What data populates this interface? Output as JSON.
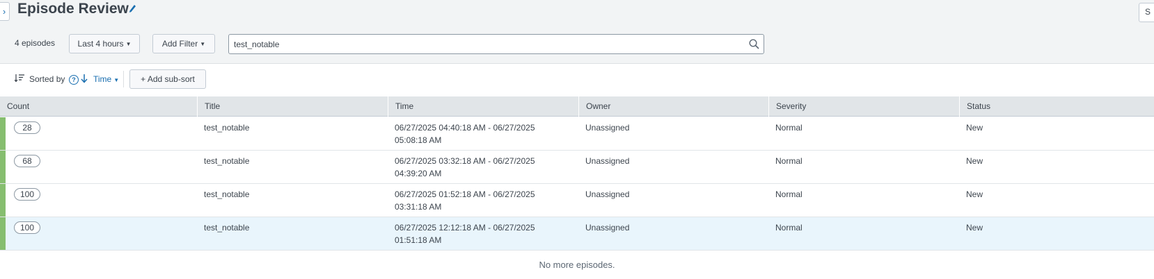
{
  "header": {
    "title": "Episode Review",
    "corner_button_label": "S"
  },
  "toolbar": {
    "episode_count": "4 episodes",
    "time_range_label": "Last 4 hours",
    "add_filter_label": "Add Filter",
    "search_value": "test_notable"
  },
  "sort": {
    "sorted_by_label": "Sorted by",
    "help_glyph": "?",
    "field_label": "Time",
    "direction": "descending",
    "add_subsort_label": "+ Add sub-sort"
  },
  "table": {
    "columns": [
      "Count",
      "Title",
      "Time",
      "Owner",
      "Severity",
      "Status"
    ],
    "rows": [
      {
        "count": "28",
        "title": "test_notable",
        "time": "06/27/2025 04:40:18 AM - 06/27/2025 05:08:18 AM",
        "owner": "Unassigned",
        "severity": "Normal",
        "status": "New"
      },
      {
        "count": "68",
        "title": "test_notable",
        "time": "06/27/2025 03:32:18 AM - 06/27/2025 04:39:20 AM",
        "owner": "Unassigned",
        "severity": "Normal",
        "status": "New"
      },
      {
        "count": "100",
        "title": "test_notable",
        "time": "06/27/2025 01:52:18 AM - 06/27/2025 03:31:18 AM",
        "owner": "Unassigned",
        "severity": "Normal",
        "status": "New"
      },
      {
        "count": "100",
        "title": "test_notable",
        "time": "06/27/2025 12:12:18 AM - 06/27/2025 01:51:18 AM",
        "owner": "Unassigned",
        "severity": "Normal",
        "status": "New"
      }
    ],
    "selected_row": 3,
    "footer_text": "No more episodes."
  },
  "colors": {
    "accent": "#1a6fb0",
    "severity_normal": "#86be6f",
    "selected_row_bg": "#e9f5fc",
    "header_bg": "#f2f4f5"
  },
  "icons": [
    "chevron-right-icon",
    "pencil-icon",
    "search-icon",
    "sort-list-icon",
    "help-icon",
    "arrow-down-icon",
    "caret-down-icon"
  ]
}
